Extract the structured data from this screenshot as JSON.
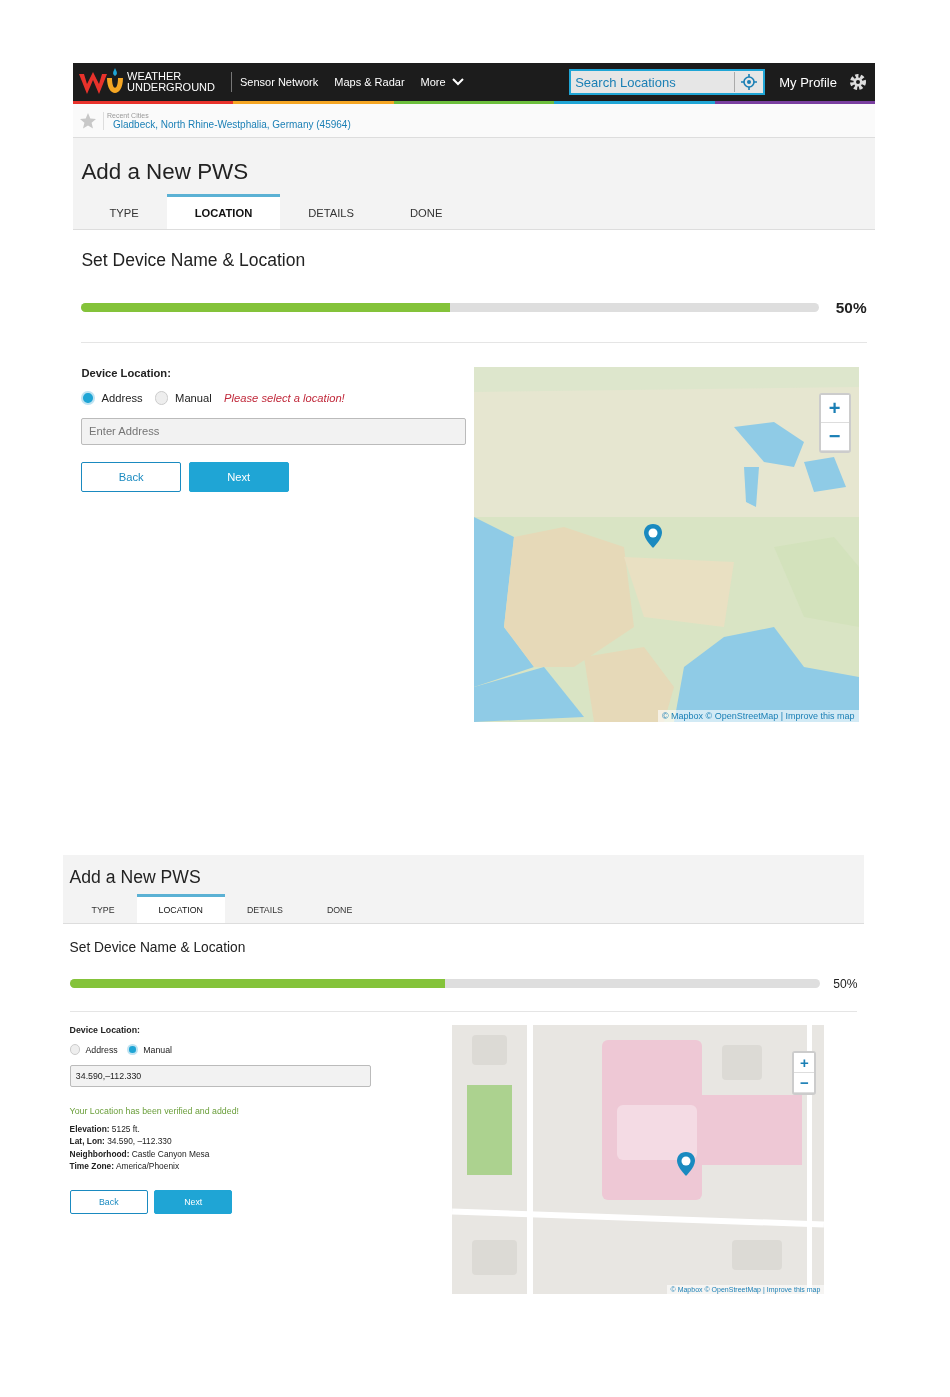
{
  "screens": [
    {
      "header": {
        "logo_lines": [
          "WEATHER",
          "UNDERGROUND"
        ],
        "nav": [
          "Sensor Network",
          "Maps & Radar",
          "More"
        ],
        "search": {
          "placeholder": "Search Locations"
        },
        "profile": "My Profile"
      },
      "recent": {
        "label": "Recent Cities",
        "city": "Gladbeck, North Rhine-Westphalia, Germany (45964)"
      },
      "title": "Add a New PWS",
      "tabs": [
        {
          "label": "TYPE",
          "selected": false
        },
        {
          "label": "LOCATION",
          "selected": true
        },
        {
          "label": "DETAILS",
          "selected": false
        },
        {
          "label": "DONE",
          "selected": false
        }
      ],
      "subtitle": "Set Device Name & Location",
      "progress": {
        "level": 0.5,
        "reading": "50%"
      },
      "form": {
        "label": "Device Location:",
        "options": [
          {
            "label": "Address",
            "selected": true
          },
          {
            "label": "Manual",
            "selected": false
          }
        ],
        "error": "Please select a location!",
        "address": {
          "placeholder": "Enter Address"
        },
        "buttons": [
          "Back",
          "Next"
        ]
      },
      "map": {
        "zoom_controls": [
          "+",
          "−"
        ],
        "attribution": "© Mapbox © OpenStreetMap | Improve this map"
      }
    },
    {
      "title": "Add a New PWS",
      "tabs": [
        {
          "label": "TYPE",
          "selected": false
        },
        {
          "label": "LOCATION",
          "selected": true
        },
        {
          "label": "DETAILS",
          "selected": false
        },
        {
          "label": "DONE",
          "selected": false
        }
      ],
      "subtitle": "Set Device Name & Location",
      "progress": {
        "level": 0.5,
        "reading": "50%"
      },
      "form": {
        "label": "Device Location:",
        "options": [
          {
            "label": "Address",
            "selected": false
          },
          {
            "label": "Manual",
            "selected": true
          }
        ],
        "address": {
          "value": "34.590,–112.330"
        },
        "status": "Your Location has been verified and added!",
        "details": [
          "**Elevation:** 5125 ft.",
          "**Lat, Lon:** 34.590, –112.330",
          "**Neighborhood:** Castle Canyon Mesa",
          "**Time Zone:** America/Phoenix"
        ],
        "buttons": [
          "Back",
          "Next"
        ]
      },
      "map": {
        "zoom_controls": [
          "+",
          "−"
        ],
        "attribution": "© Mapbox © OpenStreetMap | Improve this map"
      }
    }
  ]
}
